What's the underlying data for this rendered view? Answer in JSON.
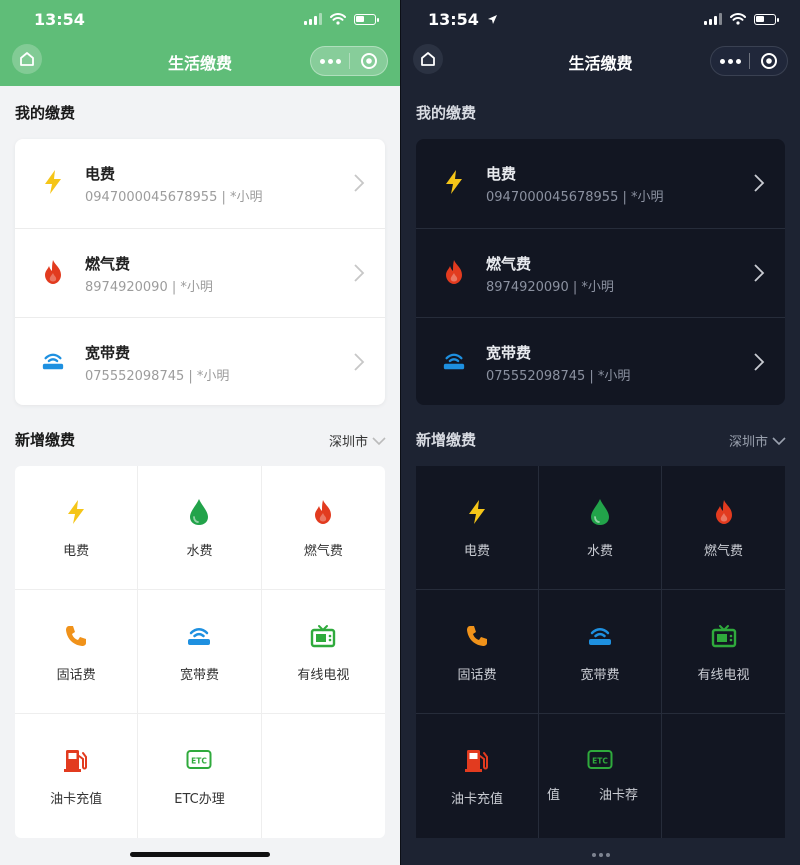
{
  "status_time": "13:54",
  "nav_title": "生活缴费",
  "sections": {
    "my_bills": "我的缴费",
    "new_bills": "新增缴费",
    "city": "深圳市"
  },
  "bills": [
    {
      "name": "电费",
      "account": "0947000045678955 | *小明",
      "icon": "lightning-icon"
    },
    {
      "name": "燃气费",
      "account": "8974920090 | *小明",
      "icon": "flame-icon"
    },
    {
      "name": "宽带费",
      "account": "075552098745 | *小明",
      "icon": "wifi-router-icon"
    }
  ],
  "services": [
    {
      "label": "电费",
      "icon": "lightning-icon"
    },
    {
      "label": "水费",
      "icon": "water-drop-icon"
    },
    {
      "label": "燃气费",
      "icon": "flame-icon"
    },
    {
      "label": "固话费",
      "icon": "phone-icon"
    },
    {
      "label": "宽带费",
      "icon": "wifi-router-icon"
    },
    {
      "label": "有线电视",
      "icon": "tv-icon"
    },
    {
      "label": "油卡充值",
      "icon": "fuel-pump-icon"
    },
    {
      "label": "ETC办理",
      "icon": "etc-icon"
    }
  ],
  "dark_services_last_row": [
    "油卡充值",
    "值",
    "油卡荐"
  ],
  "colors": {
    "light_header": "#5fbd78",
    "dark_bg": "#1d2332",
    "lightning": "#f5c518",
    "flame": "#e23b1f",
    "water": "#22a34a",
    "wifi": "#1e90e0",
    "phone": "#f0921a",
    "tv": "#2faa3c",
    "fuel": "#e23b1f",
    "etc": "#2faa3c"
  }
}
